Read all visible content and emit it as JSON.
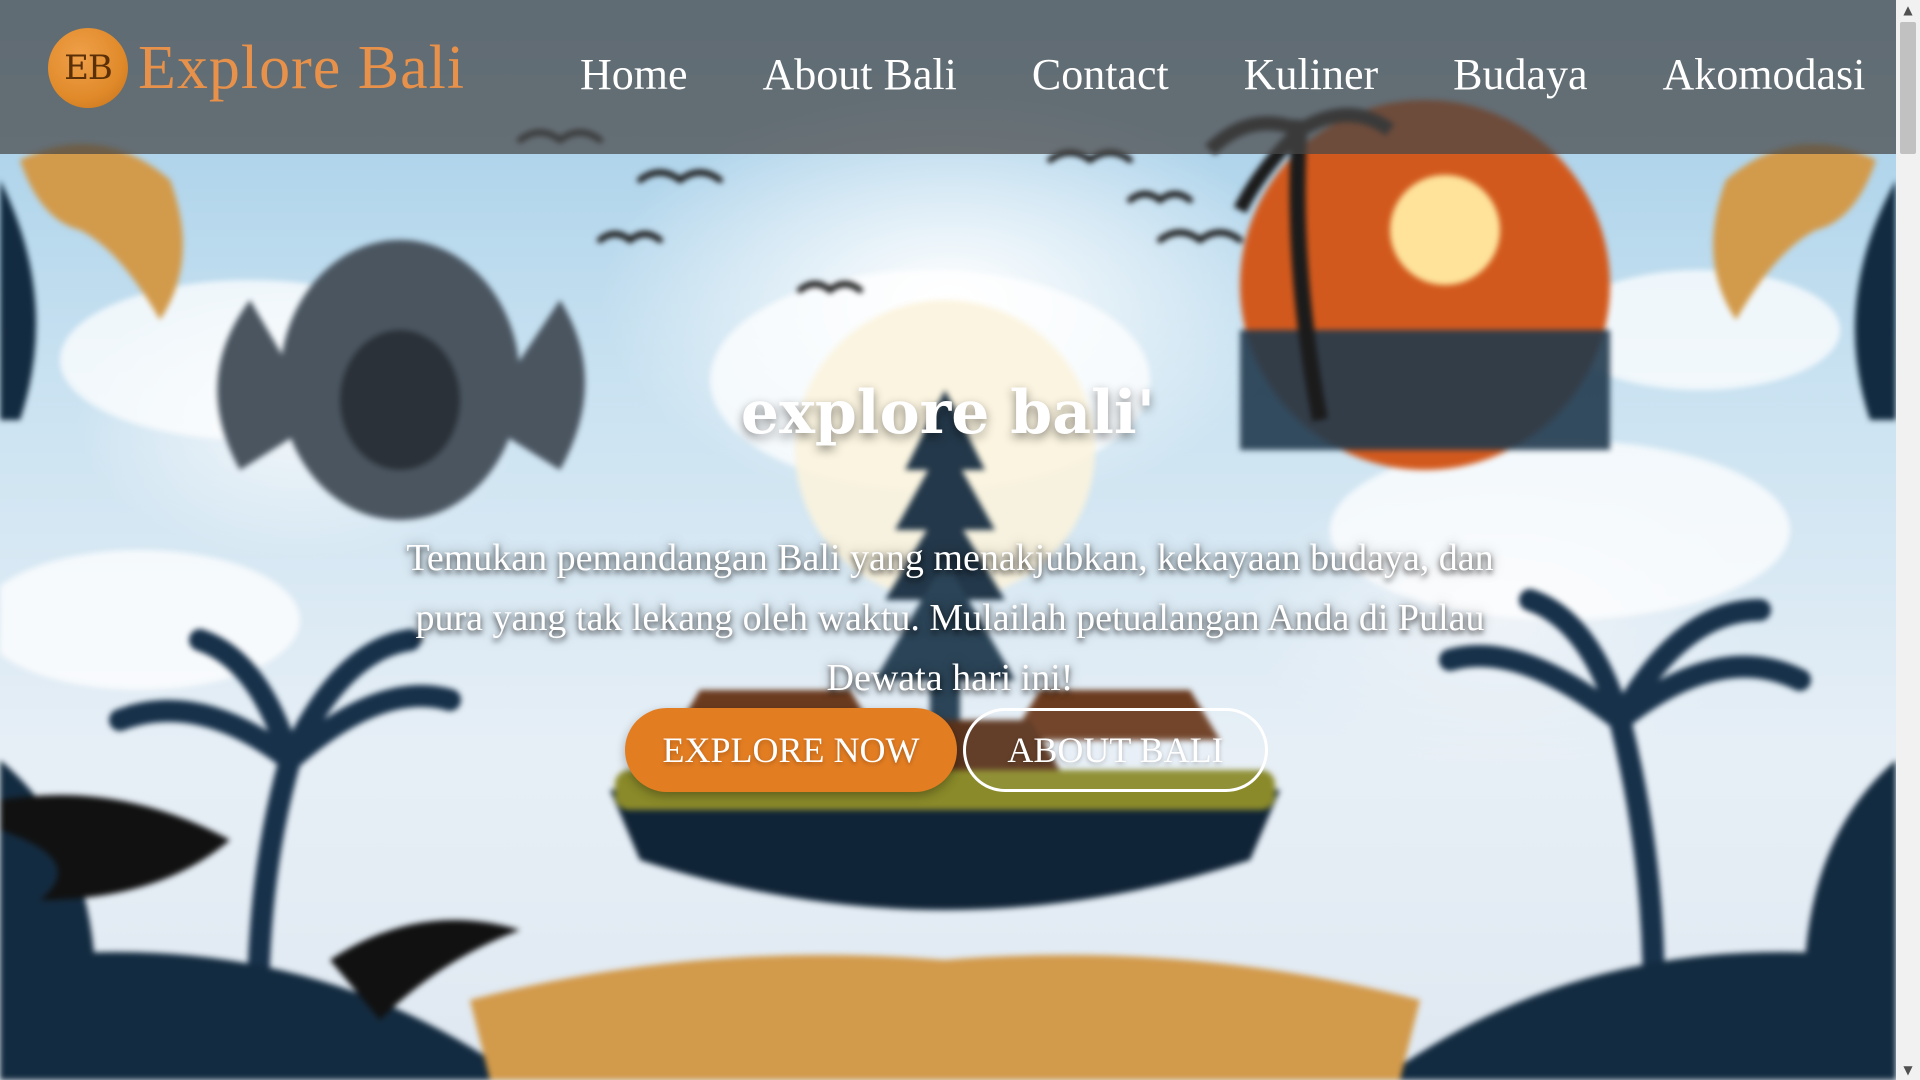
{
  "brand": {
    "logo_text": "EB",
    "name": "Explore Bali"
  },
  "nav": {
    "items": [
      {
        "label": "Home"
      },
      {
        "label": "About Bali"
      },
      {
        "label": "Contact"
      },
      {
        "label": "Kuliner"
      },
      {
        "label": "Budaya"
      },
      {
        "label": "Akomodasi"
      }
    ]
  },
  "hero": {
    "title": "explore bali'",
    "description": "Temukan pemandangan Bali yang menakjubkan, kekayaan budaya, dan pura yang tak lekang oleh waktu. Mulailah petualangan Anda di Pulau Dewata hari ini!",
    "primary_button": "EXPLORE NOW",
    "secondary_button": "ABOUT BALI"
  },
  "colors": {
    "accent": "#e37d22",
    "brand_text": "#e7914a",
    "navbar_bg": "rgba(70,70,70,0.72)"
  },
  "icons": {
    "scroll_up": "▲",
    "scroll_down": "▼"
  }
}
